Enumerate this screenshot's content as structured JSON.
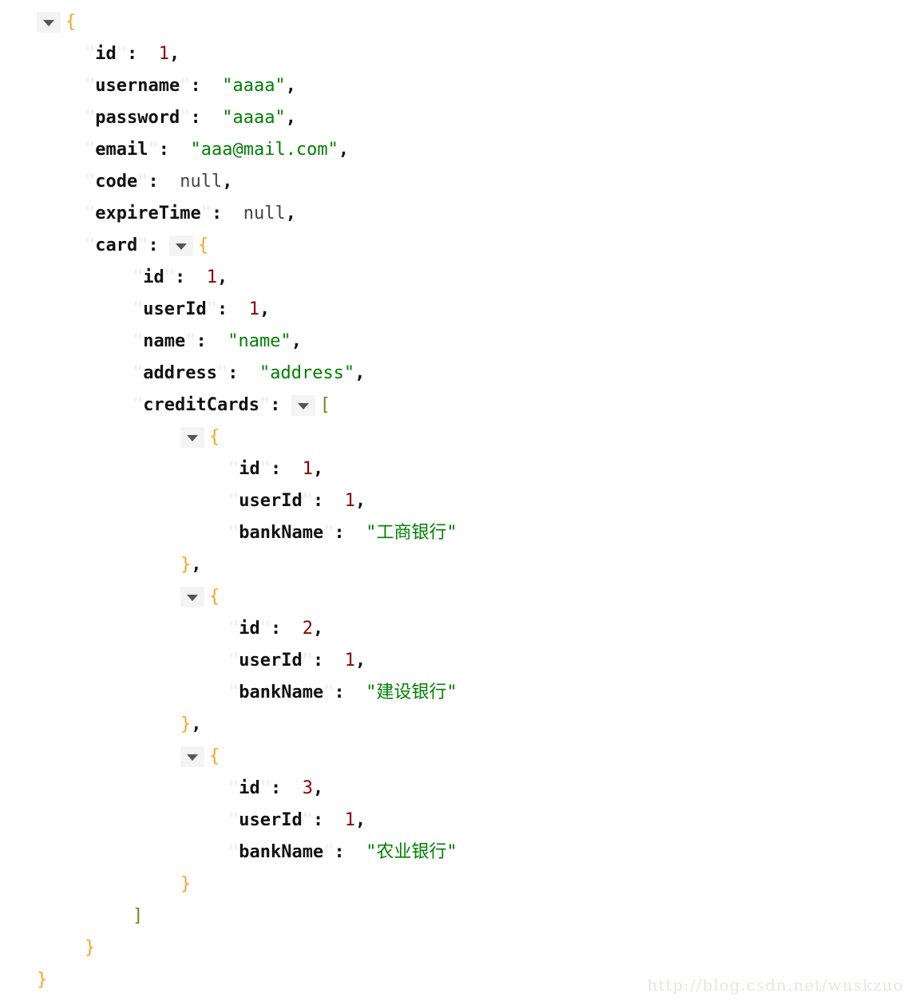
{
  "viewer": {
    "title": "JSON tree viewer",
    "colors": {
      "key": "#111111",
      "key_quote_faint": "#eeeeee",
      "string": "#008000",
      "number": "#8b0000",
      "null": "#444444",
      "brace": "#f5a623",
      "bracket": "#7f7f1e",
      "toggle_bg": "#f4f4f4",
      "toggle_arrow": "#555555",
      "background": "#ffffff",
      "watermark": "#e8e6e2"
    },
    "toggle_icon": "caret-down-icon",
    "toggle_state": "expanded"
  },
  "watermark": {
    "text": "http://blog.csdn.net/wuskzuo"
  },
  "punctuation": {
    "quote": "\"",
    "colon": ":",
    "comma": ",",
    "open_brace": "{",
    "close_brace": "}",
    "close_brace_comma": "},",
    "open_bracket": "[",
    "close_bracket": "]"
  },
  "keys": {
    "id": "id",
    "username": "username",
    "password": "password",
    "email": "email",
    "code": "code",
    "expireTime": "expireTime",
    "card": "card",
    "userId": "userId",
    "name": "name",
    "address": "address",
    "creditCards": "creditCards",
    "bankName": "bankName"
  },
  "values": {
    "root_id": "1",
    "username": "\"aaaa\"",
    "password": "\"aaaa\"",
    "email": "\"aaa@mail.com\"",
    "code": "null",
    "expireTime": "null",
    "card_id": "1",
    "card_userId": "1",
    "card_name": "\"name\"",
    "card_address": "\"address\"",
    "cc1_id": "1",
    "cc1_userId": "1",
    "cc1_bankName": "\"工商银行\"",
    "cc2_id": "2",
    "cc2_userId": "1",
    "cc2_bankName": "\"建设银行\"",
    "cc3_id": "3",
    "cc3_userId": "1",
    "cc3_bankName": "\"农业银行\""
  },
  "json_document": {
    "id": 1,
    "username": "aaaa",
    "password": "aaaa",
    "email": "aaa@mail.com",
    "code": null,
    "expireTime": null,
    "card": {
      "id": 1,
      "userId": 1,
      "name": "name",
      "address": "address",
      "creditCards": [
        {
          "id": 1,
          "userId": 1,
          "bankName": "工商银行"
        },
        {
          "id": 2,
          "userId": 1,
          "bankName": "建设银行"
        },
        {
          "id": 3,
          "userId": 1,
          "bankName": "农业银行"
        }
      ]
    }
  }
}
